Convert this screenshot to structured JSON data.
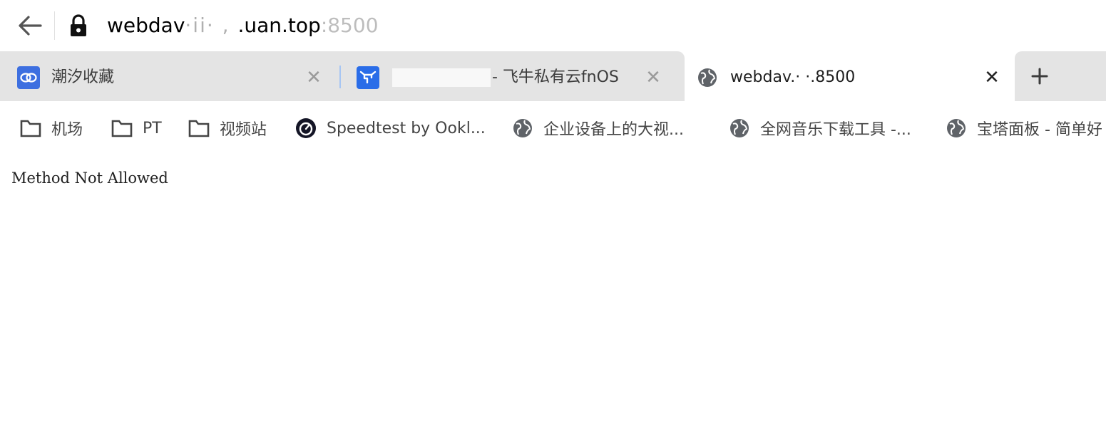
{
  "address_bar": {
    "url_host": "webdav",
    "url_obscured": "·ii· ,  ",
    "url_tld": ".uan.top",
    "url_port": ":8500"
  },
  "tabs": [
    {
      "title": "潮汐收藏",
      "icon": "cloud-rings-icon",
      "active": false
    },
    {
      "title": "- 飞牛私有云fnOS",
      "icon": "fnos-bull-icon",
      "active": false
    },
    {
      "title": "webdav.·  ·.8500",
      "icon": "globe-icon",
      "active": true
    }
  ],
  "bookmarks": [
    {
      "label": "机场",
      "icon": "folder-icon"
    },
    {
      "label": "PT",
      "icon": "folder-icon"
    },
    {
      "label": "视频站",
      "icon": "folder-icon"
    },
    {
      "label": "Speedtest by Ookl...",
      "icon": "speedtest-icon"
    },
    {
      "label": "企业设备上的大视...",
      "icon": "globe-icon"
    },
    {
      "label": "全网音乐下载工具 -...",
      "icon": "globe-icon"
    },
    {
      "label": "宝塔面板 - 简单好",
      "icon": "globe-icon"
    }
  ],
  "page": {
    "message": "Method Not Allowed"
  },
  "colors": {
    "tab_inactive_bg": "#e4e4e4",
    "tab_active_bg": "#ffffff",
    "favicon_blue": "#2f6fe6"
  }
}
